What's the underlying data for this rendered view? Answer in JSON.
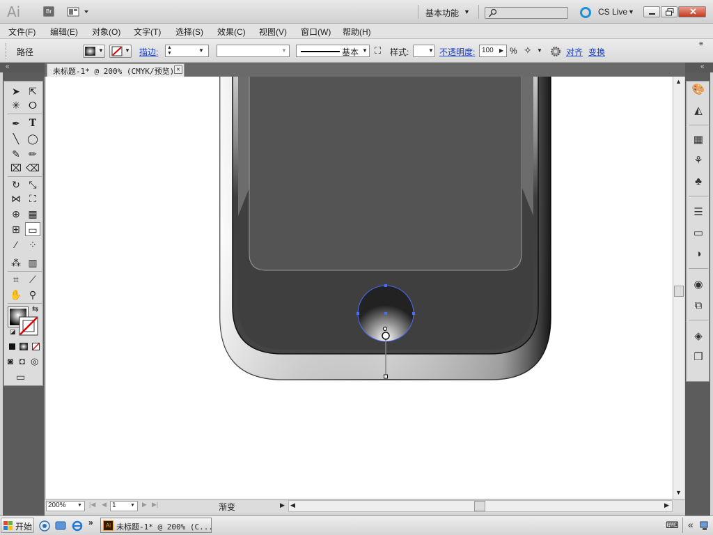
{
  "app": {
    "logo": "Ai",
    "bridge_label": "Br",
    "workspace_label": "基本功能",
    "search_placeholder": "",
    "cslive_label": "CS Live"
  },
  "menu": {
    "items": [
      "文件(F)",
      "编辑(E)",
      "对象(O)",
      "文字(T)",
      "选择(S)",
      "效果(C)",
      "视图(V)",
      "窗口(W)",
      "帮助(H)"
    ]
  },
  "control": {
    "path_label": "路径",
    "stroke_label": "描边:",
    "stroke_profile": "基本",
    "style_label": "样式:",
    "opacity_label": "不透明度:",
    "opacity_value": "100",
    "percent": "%",
    "align_label": "对齐",
    "transform_label": "变换"
  },
  "document": {
    "tab_title": "未标题-1* @ 200% (CMYK/预览)"
  },
  "status": {
    "zoom": "200%",
    "page": "1",
    "tool_label": "渐变"
  },
  "taskbar": {
    "start_label": "开始",
    "task_label": "未标题-1* @ 200% (C..."
  },
  "colors": {
    "accent_blue": "#1a3fcc",
    "panel_dark": "#5c5c5c",
    "anchor_blue": "#4a6cff"
  }
}
